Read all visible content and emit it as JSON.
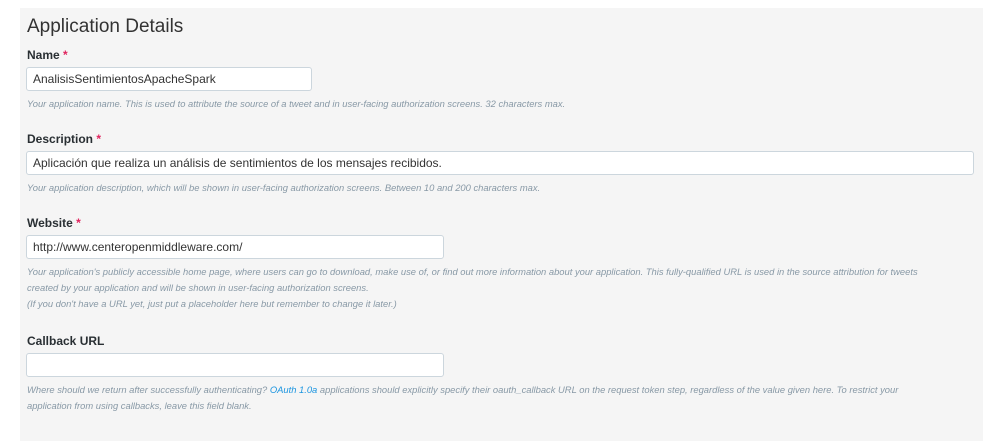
{
  "section_title": "Application Details",
  "fields": {
    "name": {
      "label": "Name",
      "required_mark": "*",
      "value": "AnalisisSentimientosApacheSpark",
      "help": "Your application name. This is used to attribute the source of a tweet and in user-facing authorization screens. 32 characters max."
    },
    "description": {
      "label": "Description",
      "required_mark": "*",
      "value": "Aplicación que realiza un análisis de sentimientos de los mensajes recibidos.",
      "help": "Your application description, which will be shown in user-facing authorization screens. Between 10 and 200 characters max."
    },
    "website": {
      "label": "Website",
      "required_mark": "*",
      "value": "http://www.centeropenmiddleware.com/",
      "help_line1": "Your application's publicly accessible home page, where users can go to download, make use of, or find out more information about your application. This fully-qualified URL is used in the source attribution for tweets",
      "help_line2": "created by your application and will be shown in user-facing authorization screens.",
      "help_line3": "(If you don't have a URL yet, just put a placeholder here but remember to change it later.)"
    },
    "callback": {
      "label": "Callback URL",
      "value": "",
      "help_before_link": "Where should we return after successfully authenticating? ",
      "help_link": "OAuth 1.0a",
      "help_after_link": " applications should explicitly specify their oauth_callback URL on the request token step, regardless of the value given here. To restrict your",
      "help_line2": "application from using callbacks, leave this field blank."
    }
  }
}
